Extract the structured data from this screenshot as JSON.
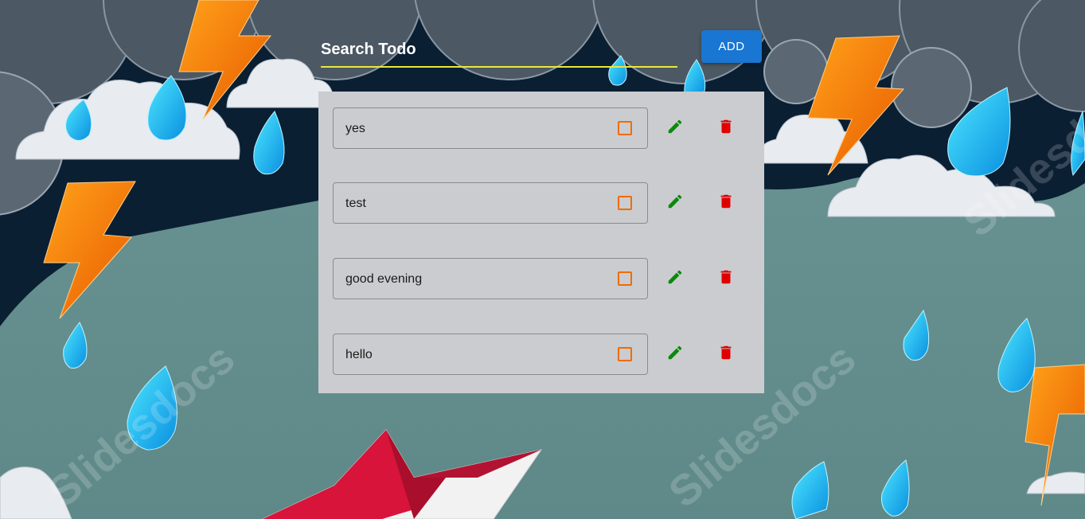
{
  "search": {
    "placeholder": "Search Todo",
    "value": "",
    "underline_color": "#e8e83a"
  },
  "add_button": {
    "label": "ADD",
    "color": "#1976d2"
  },
  "todos": [
    {
      "text": "yes",
      "checked": false
    },
    {
      "text": "test",
      "checked": false
    },
    {
      "text": "good evening",
      "checked": false
    },
    {
      "text": "hello",
      "checked": false
    }
  ],
  "icons": {
    "edit": "pencil-icon",
    "delete": "trash-icon",
    "checkbox": "checkbox-outline-icon"
  },
  "colors": {
    "panel_bg": "#cbcccf",
    "checkbox": "#ef6c00",
    "edit_icon": "#0a8a0a",
    "delete_icon": "#e00000"
  },
  "background": {
    "watermark": "Slidesdocs"
  }
}
